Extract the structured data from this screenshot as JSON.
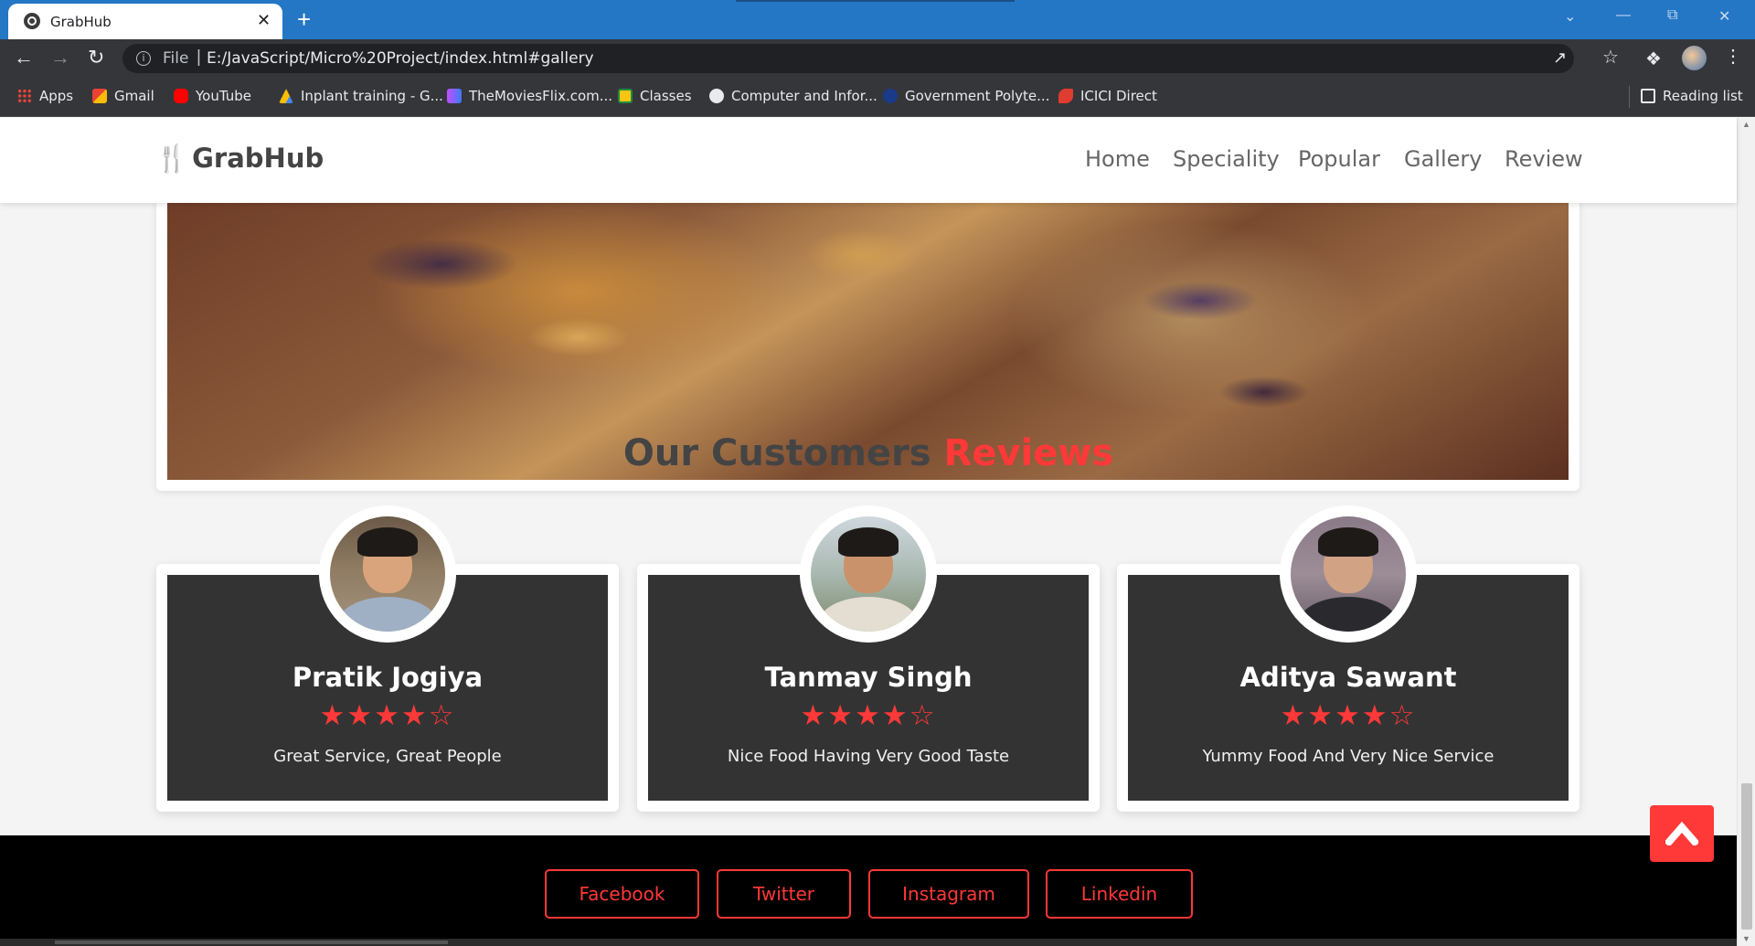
{
  "browser": {
    "tab_title": "GrabHub",
    "tab_close": "✕",
    "new_tab": "+",
    "file_label": "File",
    "url": "E:/JavaScript/Micro%20Project/index.html#gallery",
    "bookmarks": [
      {
        "label": "Apps",
        "icon": "apps-grid-icon",
        "color": "#4285f4"
      },
      {
        "label": "Gmail",
        "icon": "gmail-icon",
        "color": "#ea4335"
      },
      {
        "label": "YouTube",
        "icon": "youtube-icon",
        "color": "#ff0000"
      },
      {
        "label": "Inplant training - G...",
        "icon": "google-drive-icon",
        "color": "#fbbc04"
      },
      {
        "label": "TheMoviesFlix.com...",
        "icon": "moviesflix-icon",
        "color": "#c44dff"
      },
      {
        "label": "Classes",
        "icon": "classroom-icon",
        "color": "#f9c413"
      },
      {
        "label": "Computer and Infor...",
        "icon": "globe-icon",
        "color": "#e8eaed"
      },
      {
        "label": "Government Polyte...",
        "icon": "polytechnic-icon",
        "color": "#1a3a8a"
      },
      {
        "label": "ICICI Direct",
        "icon": "icici-icon",
        "color": "#e03c31"
      }
    ],
    "reading_list": "Reading list"
  },
  "site": {
    "logo": "GrabHub",
    "nav": [
      "Home",
      "Speciality",
      "Popular",
      "Gallery",
      "Review"
    ],
    "reviews_title_main": "Our Customers",
    "reviews_title_accent": "Reviews",
    "reviews": [
      {
        "name": "Pratik Jogiya",
        "rating": 4,
        "max_rating": 5,
        "text": "Great Service, Great People"
      },
      {
        "name": "Tanmay Singh",
        "rating": 4,
        "max_rating": 5,
        "text": "Nice Food Having Very Good Taste"
      },
      {
        "name": "Aditya Sawant",
        "rating": 4,
        "max_rating": 5,
        "text": "Yummy Food And Very Nice Service"
      }
    ],
    "socials": [
      "Facebook",
      "Twitter",
      "Instagram",
      "Linkedin"
    ]
  },
  "colors": {
    "accent": "#ff3838",
    "browser_tabbar": "#2477c4",
    "card_dark": "#333333",
    "footer": "#000000"
  }
}
